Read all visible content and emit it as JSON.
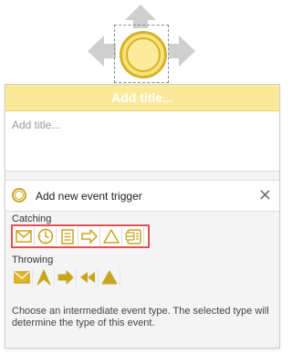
{
  "canvas": {
    "shape": "intermediate-event",
    "move_arrows": [
      "move-up-arrow",
      "move-left-arrow",
      "move-right-arrow"
    ]
  },
  "panel": {
    "title_header": "Add title...",
    "title_placeholder": "Add title...",
    "trigger": {
      "label": "Add new event trigger",
      "close_glyph": "×"
    },
    "catching": {
      "label": "Catching",
      "items": [
        {
          "name": "message-catch-icon"
        },
        {
          "name": "timer-catch-icon"
        },
        {
          "name": "conditional-catch-icon"
        },
        {
          "name": "link-catch-icon"
        },
        {
          "name": "signal-catch-icon"
        },
        {
          "name": "escalation-catch-icon"
        }
      ]
    },
    "throwing": {
      "label": "Throwing",
      "items": [
        {
          "name": "message-throw-icon"
        },
        {
          "name": "escalation-throw-icon"
        },
        {
          "name": "link-throw-icon"
        },
        {
          "name": "compensation-throw-icon"
        },
        {
          "name": "signal-throw-icon"
        }
      ]
    },
    "help_text": "Choose an intermediate event type. The selected type will determine the type of this event."
  },
  "colors": {
    "accent_yellow": "#fbe99a",
    "icon_gold": "#c9a51f",
    "highlight_red": "#e05252"
  }
}
